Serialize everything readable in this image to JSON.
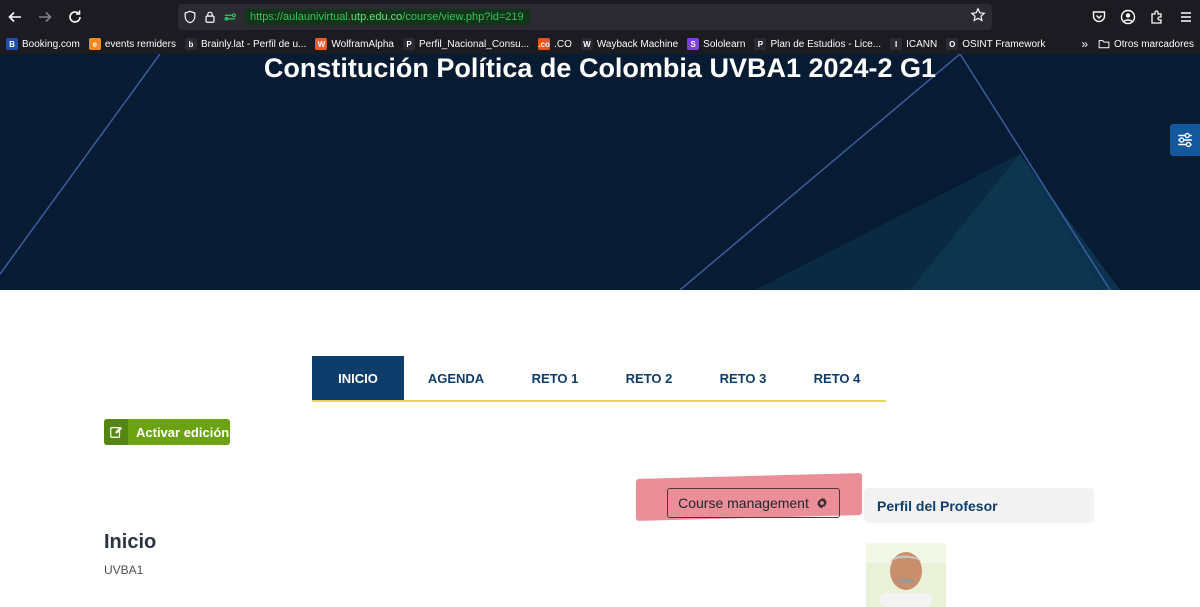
{
  "browser": {
    "url_prefix": "https://aulaunivirtual.",
    "url_domain": "utp.edu.co",
    "url_path": "/course/view.php?id=219",
    "bookmarks": [
      {
        "label": "Booking.com",
        "color": "#1f4fa6",
        "glyph": "B"
      },
      {
        "label": "events remiders",
        "color": "#f58a1f",
        "glyph": "e"
      },
      {
        "label": "Brainly.lat - Perfil de u...",
        "color": "#2b2a33",
        "glyph": "b"
      },
      {
        "label": "WolframAlpha",
        "color": "#f0591f",
        "glyph": "W"
      },
      {
        "label": "Perfil_Nacional_Consu...",
        "color": "#2b2a33",
        "glyph": "P"
      },
      {
        "label": ".CO",
        "color": "#e8531f",
        "glyph": ".co"
      },
      {
        "label": "Wayback Machine",
        "color": "#2b2a33",
        "glyph": "W"
      },
      {
        "label": "Sololearn",
        "color": "#7b3fe4",
        "glyph": "S"
      },
      {
        "label": "Plan de Estudios - Lice...",
        "color": "#2b2a33",
        "glyph": "P"
      },
      {
        "label": "ICANN",
        "color": "#2b2a33",
        "glyph": "I"
      },
      {
        "label": "OSINT Framework",
        "color": "#2b2a33",
        "glyph": "O"
      }
    ],
    "other_bookmarks": "Otros marcadores"
  },
  "course": {
    "title": "Constitución Política de Colombia UVBA1 2024-2 G1"
  },
  "tabs": [
    {
      "label": "INICIO",
      "active": true
    },
    {
      "label": "AGENDA",
      "active": false
    },
    {
      "label": "RETO 1",
      "active": false
    },
    {
      "label": "RETO 2",
      "active": false
    },
    {
      "label": "RETO 3",
      "active": false
    },
    {
      "label": "RETO 4",
      "active": false
    }
  ],
  "actions": {
    "edit_mode": "Activar edición",
    "course_management": "Course management"
  },
  "sidebar": {
    "profile_title": "Perfil del Profesor"
  },
  "section": {
    "title": "Inicio",
    "subtitle": "UVBA1"
  },
  "colors": {
    "hero_bg": "#071b33",
    "primary": "#0f3d6b",
    "accent_line": "#e8d35b",
    "edit_green": "#6ba212",
    "highlight": "#ec8e97"
  }
}
